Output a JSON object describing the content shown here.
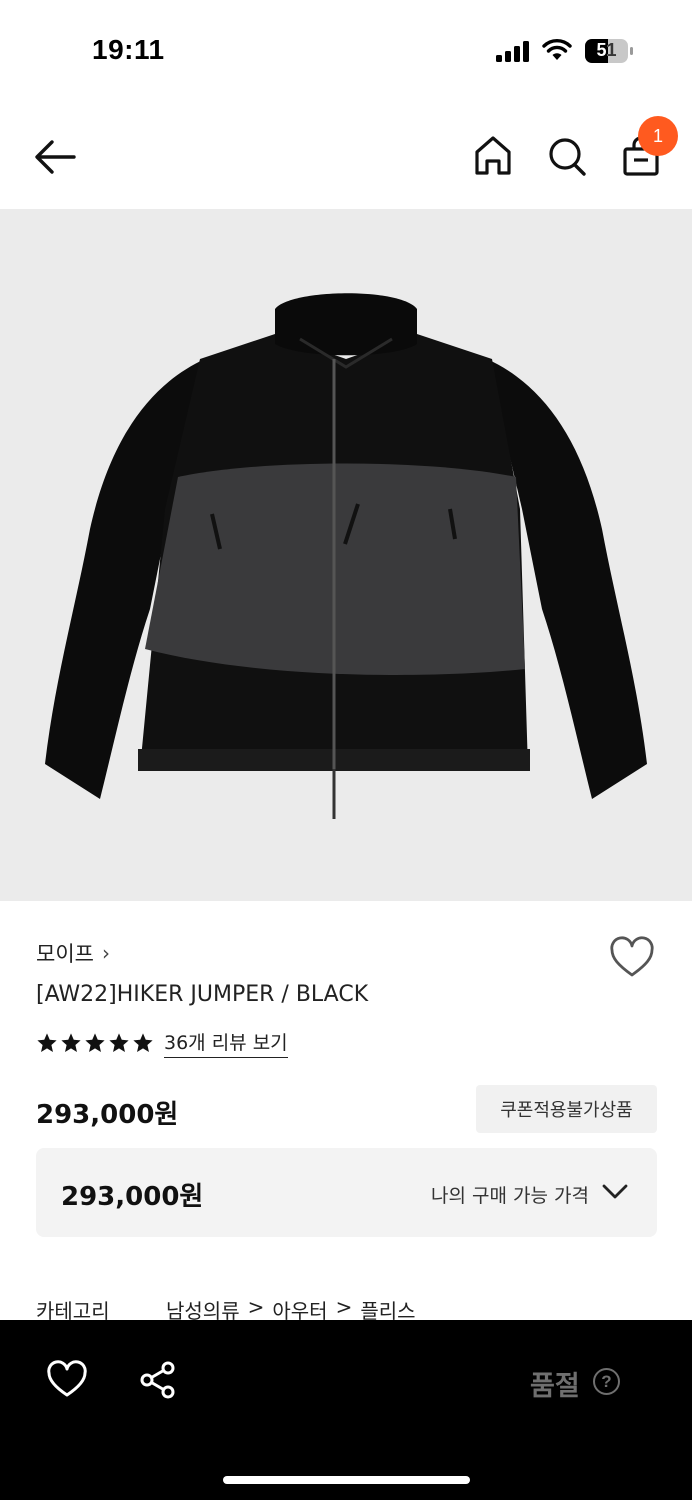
{
  "status_bar": {
    "time": "19:11",
    "battery": "51"
  },
  "nav": {
    "cart_count": "1",
    "icons": [
      "back-arrow-icon",
      "home-icon",
      "search-icon",
      "shopping-bag-icon"
    ]
  },
  "product": {
    "image_alt": "black fleece jacket with grey nylon panel",
    "brand": "모이프",
    "brand_chevron": "›",
    "title": "[AW22]HIKER JUMPER / BLACK",
    "rating_stars": 5,
    "review_link": "36개 리뷰 보기",
    "price": "293,000원",
    "coupon_badge": "쿠폰적용불가상품",
    "my_price": {
      "value": "293,000원",
      "label": "나의 구매 가능 가격"
    },
    "category": {
      "label": "카테고리",
      "path": [
        "남성의류",
        ">",
        "아우터",
        ">",
        "플리스"
      ]
    }
  },
  "bottom_bar": {
    "soldout_label": "품절",
    "help_glyph": "?"
  },
  "colors": {
    "badge": "#ff5a1f",
    "image_bg": "#ebebeb",
    "bottom_bar_bg": "#000000",
    "soldout_text": "#6f6f6f"
  }
}
